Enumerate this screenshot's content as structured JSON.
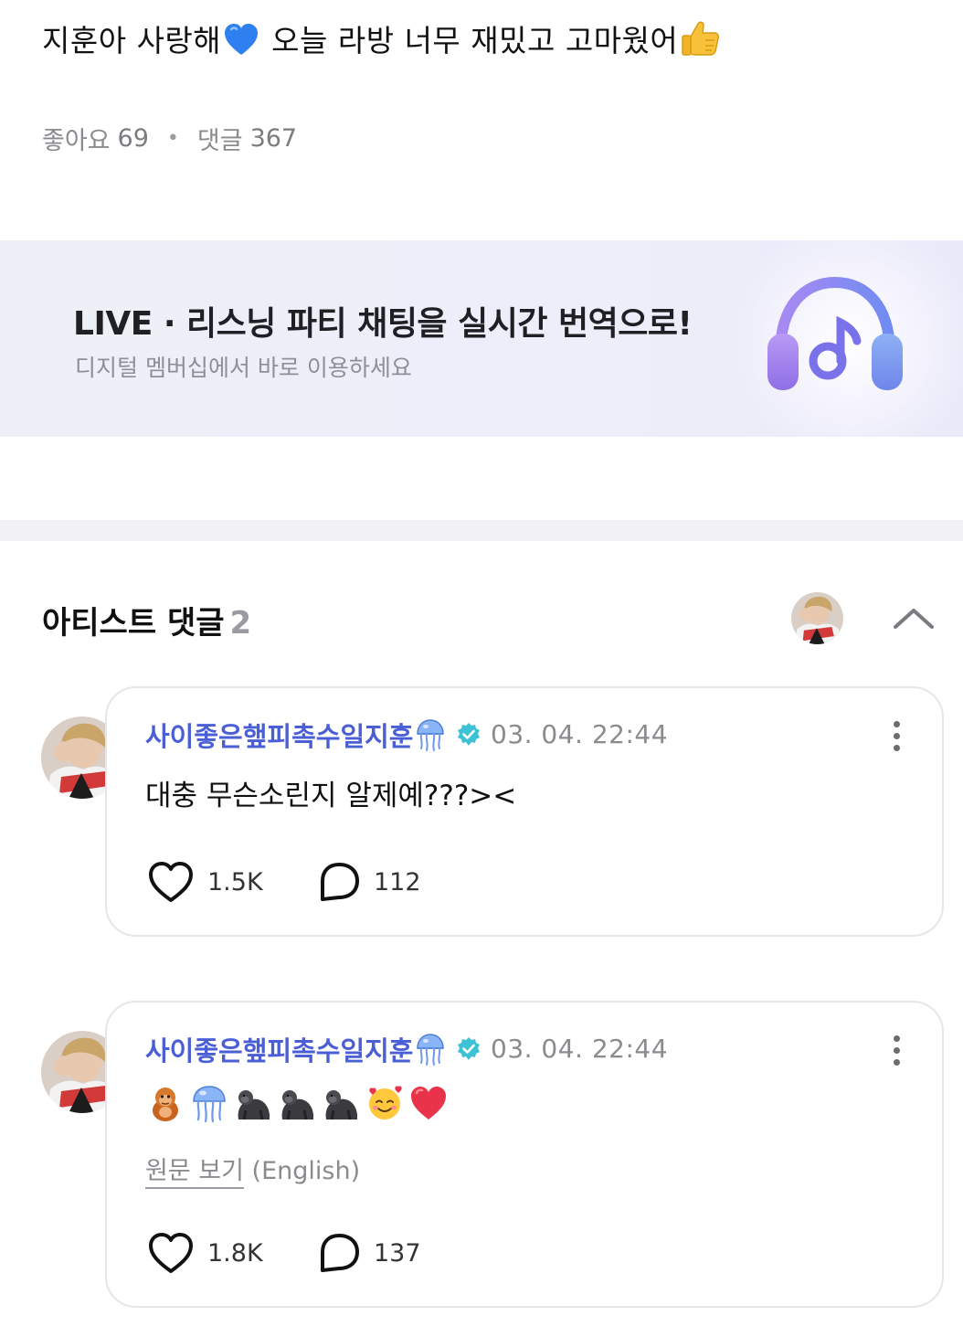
{
  "post": {
    "text_part1": "지훈아 사랑해",
    "text_part2": " 오늘 라방 너무 재밌고 고마웠어",
    "likes_label": "좋아요",
    "likes_count": "69",
    "comments_label": "댓글",
    "comments_count": "367"
  },
  "banner": {
    "title": "LIVE · 리스닝 파티 채팅을 실시간 번역으로!",
    "subtitle": "디지털 멤버십에서 바로 이용하세요",
    "icon": "headphones-music-icon"
  },
  "artist_comments": {
    "title": "아티스트 댓글",
    "count": "2",
    "collapse_icon": "chevron-up-icon",
    "items": [
      {
        "author": "사이좋은햎피촉수일지훈",
        "date": "03. 04. 22:44",
        "text": "대충 무슨소린지 알제예???><",
        "likes": "1.5K",
        "replies": "112"
      },
      {
        "author": "사이좋은햎피촉수일지훈",
        "date": "03. 04. 22:44",
        "emojis": [
          "orangutan",
          "jellyfish",
          "gorilla",
          "gorilla",
          "gorilla",
          "smiling-face-with-hearts",
          "red-heart"
        ],
        "view_original": "원문 보기",
        "original_lang": "(English)",
        "likes": "1.8K",
        "replies": "137"
      }
    ]
  },
  "colors": {
    "author_name": "#4a5ed6",
    "verified_badge": "#3fc1d6",
    "banner_bg": "#eceef9",
    "heart_blue": "#2e7ff0"
  }
}
